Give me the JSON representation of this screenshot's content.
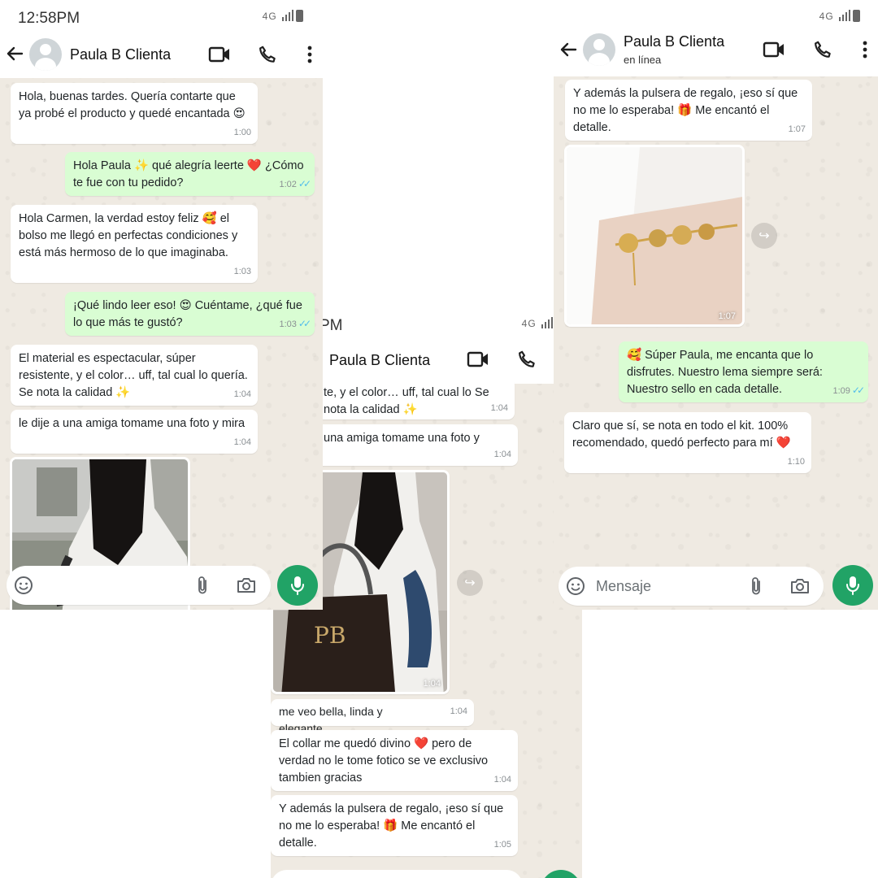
{
  "colors": {
    "outgoing_bubble": "#d9fdd3",
    "incoming_bubble": "#ffffff",
    "chat_bg": "#efeae2",
    "accent_green": "#21a366",
    "read_ticks": "#53bdeb"
  },
  "left": {
    "status_time": "12:58PM",
    "contact_name": "Paula B Clienta",
    "messages": [
      {
        "dir": "in",
        "text": "Hola, buenas tardes. Quería contarte que ya probé el producto y quedé encantada 😍",
        "time": "1:00"
      },
      {
        "dir": "out",
        "text": "Hola Paula ✨ qué alegría leerte ❤️ ¿Cómo te fue con tu pedido?",
        "time": "1:02"
      },
      {
        "dir": "in",
        "text": "Hola Carmen, la verdad estoy feliz 🥰 el bolso me llegó en perfectas condiciones y está más hermoso de lo que imaginaba.",
        "time": "1:03"
      },
      {
        "dir": "out",
        "text": "¡Qué lindo leer eso! 😍 Cuéntame, ¿qué fue lo que más te gustó?",
        "time": "1:03"
      },
      {
        "dir": "in",
        "text": "El material es espectacular, súper resistente, y el color… uff, tal cual lo quería. Se nota la calidad ✨",
        "time": "1:04"
      },
      {
        "dir": "in",
        "text": "le dije a una amiga tomame una foto y mira",
        "time": "1:04"
      }
    ]
  },
  "middle": {
    "status_time": "PM",
    "contact_name": "Paula B Clienta",
    "messages": [
      {
        "dir": "in",
        "text": "te, y el color… uff, tal cual lo Se nota la calidad ✨",
        "time": "1:04"
      },
      {
        "dir": "in",
        "text": "una amiga tomame una foto y",
        "time": "1:04"
      },
      {
        "dir": "in",
        "text": "",
        "time": "1:04",
        "photo_text": "PB"
      },
      {
        "dir": "in",
        "text": "me veo bella, linda y elegante",
        "time": "1:04"
      },
      {
        "dir": "in",
        "text": "El collar me quedó divino ❤️ pero de verdad no le tome fotico se ve exclusivo tambien gracias",
        "time": "1:04"
      },
      {
        "dir": "in",
        "text": "Y además la pulsera de regalo, ¡eso sí que no me lo esperaba! 🎁 Me encantó el detalle.",
        "time": "1:05"
      }
    ]
  },
  "right": {
    "contact_name": "Paula B Clienta",
    "contact_status": "en línea",
    "messages": [
      {
        "dir": "in",
        "text": "Y además la pulsera de regalo, ¡eso sí que no me lo esperaba! 🎁 Me encantó el detalle.",
        "time": "1:07"
      },
      {
        "dir": "in",
        "text": "",
        "time": "1:07"
      },
      {
        "dir": "out",
        "text": "🥰 Súper Paula, me encanta que lo disfrutes. Nuestro lema siempre será: Nuestro sello en cada detalle.",
        "time": "1:09"
      },
      {
        "dir": "in",
        "text": "Claro que sí, se nota en todo el kit. 100% recomendado, quedó perfecto para mí ❤️",
        "time": "1:10"
      }
    ],
    "composer_placeholder": "Mensaje"
  }
}
